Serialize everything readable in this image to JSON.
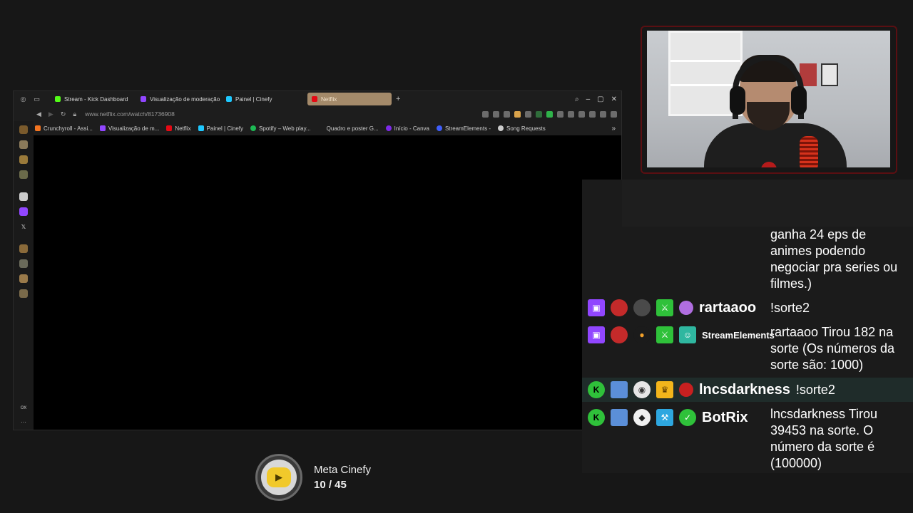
{
  "browser": {
    "tabs": [
      {
        "label": "Stream - Kick Dashboard",
        "color": "#53fc18"
      },
      {
        "label": "Visualização de moderação",
        "color": "#9146ff"
      },
      {
        "label": "Painel | Cinefy",
        "color": "#1ec8ff"
      },
      {
        "label": "Netflix",
        "color": "#e50914",
        "active": true
      }
    ],
    "new_tab": "+",
    "url": "www.netflix.com/watch/81736908",
    "bookmarks": [
      {
        "label": "Crunchyroll - Assi...",
        "color": "#f47521"
      },
      {
        "label": "Visualização de m...",
        "color": "#9146ff"
      },
      {
        "label": "Netflix",
        "color": "#e50914"
      },
      {
        "label": "Painel | Cinefy",
        "color": "#1ec8ff"
      },
      {
        "label": "Spotify – Web play...",
        "color": "#1db954"
      },
      {
        "label": "Quadro e poster G...",
        "color": "#444444"
      },
      {
        "label": "Início - Canva",
        "color": "#7d2ae8"
      },
      {
        "label": "StreamElements -",
        "color": "#3f5efb"
      },
      {
        "label": "Song Requests",
        "color": "#cccccc"
      }
    ],
    "more": "»",
    "sidebar_bottom": [
      "ox",
      "···"
    ]
  },
  "chat": {
    "prev_message": "ganha 24 eps de animes podendo negociar pra series ou filmes.)",
    "messages": [
      {
        "user": "rartaaoo",
        "text": "!sorte2"
      },
      {
        "user": "StreamElements",
        "text": "rartaaoo Tirou 182 na sorte (Os números da sorte são: 1000)"
      },
      {
        "user": "lncsdarkness",
        "text": "!sorte2"
      },
      {
        "user": "BotRix",
        "text": "lncsdarkness Tirou 39453 na sorte. O número da sorte é (100000)"
      }
    ]
  },
  "goal": {
    "title": "Meta Cinefy",
    "count": "10 / 45"
  }
}
